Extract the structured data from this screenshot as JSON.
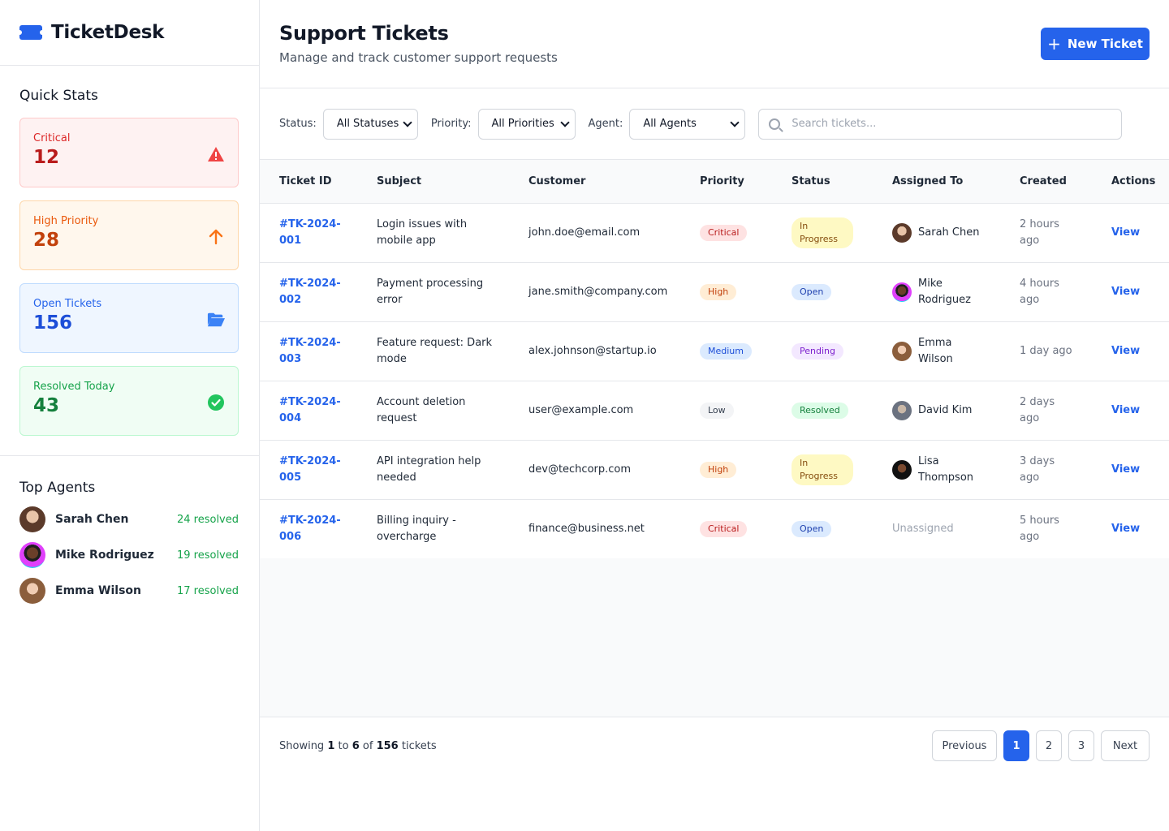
{
  "app": {
    "name": "TicketDesk"
  },
  "sidebar": {
    "quick_stats_title": "Quick Stats",
    "stats": [
      {
        "label": "Critical",
        "value": "12",
        "icon": "warning-triangle-icon",
        "color": "#dc2626"
      },
      {
        "label": "High Priority",
        "value": "28",
        "icon": "arrow-up-icon",
        "color": "#ea580c"
      },
      {
        "label": "Open Tickets",
        "value": "156",
        "icon": "folder-open-icon",
        "color": "#2563eb"
      },
      {
        "label": "Resolved Today",
        "value": "43",
        "icon": "check-circle-icon",
        "color": "#16a34a"
      }
    ],
    "top_agents_title": "Top Agents",
    "agents": [
      {
        "name": "Sarah Chen",
        "resolved": "24 resolved"
      },
      {
        "name": "Mike Rodriguez",
        "resolved": "19 resolved"
      },
      {
        "name": "Emma Wilson",
        "resolved": "17 resolved"
      }
    ]
  },
  "header": {
    "title": "Support Tickets",
    "subtitle": "Manage and track customer support requests",
    "new_ticket_label": "New Ticket"
  },
  "filters": {
    "status_label": "Status:",
    "status_value": "All Statuses",
    "priority_label": "Priority:",
    "priority_value": "All Priorities",
    "agent_label": "Agent:",
    "agent_value": "All Agents",
    "search_placeholder": "Search tickets..."
  },
  "table": {
    "columns": [
      "Ticket ID",
      "Subject",
      "Customer",
      "Priority",
      "Status",
      "Assigned To",
      "Created",
      "Actions"
    ],
    "rows": [
      {
        "id": "#TK-2024-001",
        "subject": "Login issues with mobile app",
        "customer": "john.doe@email.com",
        "priority": "Critical",
        "status": "In Progress",
        "assigned": "Sarah Chen",
        "created": "2 hours ago",
        "action": "View"
      },
      {
        "id": "#TK-2024-002",
        "subject": "Payment processing error",
        "customer": "jane.smith@company.com",
        "priority": "High",
        "status": "Open",
        "assigned": "Mike Rodriguez",
        "created": "4 hours ago",
        "action": "View"
      },
      {
        "id": "#TK-2024-003",
        "subject": "Feature request: Dark mode",
        "customer": "alex.johnson@startup.io",
        "priority": "Medium",
        "status": "Pending",
        "assigned": "Emma Wilson",
        "created": "1 day ago",
        "action": "View"
      },
      {
        "id": "#TK-2024-004",
        "subject": "Account deletion request",
        "customer": "user@example.com",
        "priority": "Low",
        "status": "Resolved",
        "assigned": "David Kim",
        "created": "2 days ago",
        "action": "View"
      },
      {
        "id": "#TK-2024-005",
        "subject": "API integration help needed",
        "customer": "dev@techcorp.com",
        "priority": "High",
        "status": "In Progress",
        "assigned": "Lisa Thompson",
        "created": "3 days ago",
        "action": "View"
      },
      {
        "id": "#TK-2024-006",
        "subject": "Billing inquiry - overcharge",
        "customer": "finance@business.net",
        "priority": "Critical",
        "status": "Open",
        "assigned": "Unassigned",
        "created": "5 hours ago",
        "action": "View"
      }
    ]
  },
  "footer": {
    "showing_prefix": "Showing",
    "showing_from": "1",
    "showing_to_word": "to",
    "showing_to": "6",
    "showing_of_word": "of",
    "showing_total": "156",
    "showing_suffix": "tickets",
    "previous_label": "Previous",
    "pages": [
      "1",
      "2",
      "3"
    ],
    "current_page": "1",
    "next_label": "Next"
  },
  "colors": {
    "accent": "#2563eb"
  }
}
